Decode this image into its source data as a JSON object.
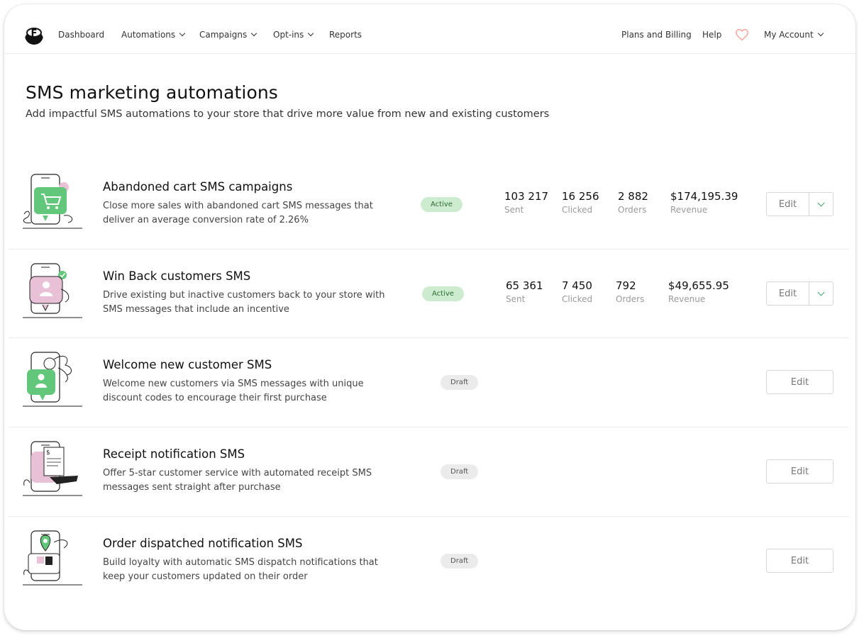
{
  "nav": {
    "logo_letter": "F",
    "links": [
      {
        "label": "Dashboard",
        "dropdown": false
      },
      {
        "label": "Automations",
        "dropdown": true
      },
      {
        "label": "Campaigns",
        "dropdown": true
      },
      {
        "label": "Opt-ins",
        "dropdown": true
      },
      {
        "label": "Reports",
        "dropdown": false
      }
    ],
    "right": {
      "plans": "Plans and Billing",
      "help": "Help",
      "account": "My Account"
    }
  },
  "header": {
    "title": "SMS marketing automations",
    "subtitle": "Add impactful SMS automations to your store that drive more value from new and existing customers"
  },
  "colors": {
    "accent_green": "#3aa568",
    "illus_green": "#62c77a",
    "illus_pink": "#e8c1d6",
    "heart": "#f4a39a"
  },
  "automations": [
    {
      "title": "Abandoned cart SMS campaigns",
      "description": "Close more sales with abandoned cart SMS messages that deliver an average conversion rate of 2.26%",
      "status": "Active",
      "icon": "shopping-cart-phone-icon",
      "stats": [
        {
          "value": "103 217",
          "label": "Sent"
        },
        {
          "value": "16 256",
          "label": "Clicked"
        },
        {
          "value": "2 882",
          "label": "Orders"
        },
        {
          "value": "$174,195.39",
          "label": "Revenue"
        }
      ],
      "edit_label": "Edit"
    },
    {
      "title": "Win Back customers SMS",
      "description": "Drive existing but inactive customers back to your store with SMS messages that include an incentive",
      "status": "Active",
      "icon": "customer-phone-icon",
      "stats": [
        {
          "value": "65 361",
          "label": "Sent"
        },
        {
          "value": "7 450",
          "label": "Clicked"
        },
        {
          "value": "792",
          "label": "Orders"
        },
        {
          "value": "$49,655.95",
          "label": "Revenue"
        }
      ],
      "edit_label": "Edit"
    },
    {
      "title": "Welcome new customer SMS",
      "description": "Welcome new customers via SMS messages with unique discount codes to encourage their first purchase",
      "status": "Draft",
      "icon": "welcome-phone-icon",
      "edit_label": "Edit"
    },
    {
      "title": "Receipt notification SMS",
      "description": "Offer 5-star customer service with automated receipt SMS messages sent straight after purchase",
      "status": "Draft",
      "icon": "receipt-phone-icon",
      "edit_label": "Edit"
    },
    {
      "title": "Order dispatched notification SMS",
      "description": "Build loyalty with automatic SMS dispatch notifications that keep your customers updated on their order",
      "status": "Draft",
      "icon": "location-pin-phone-icon",
      "edit_label": "Edit"
    }
  ]
}
